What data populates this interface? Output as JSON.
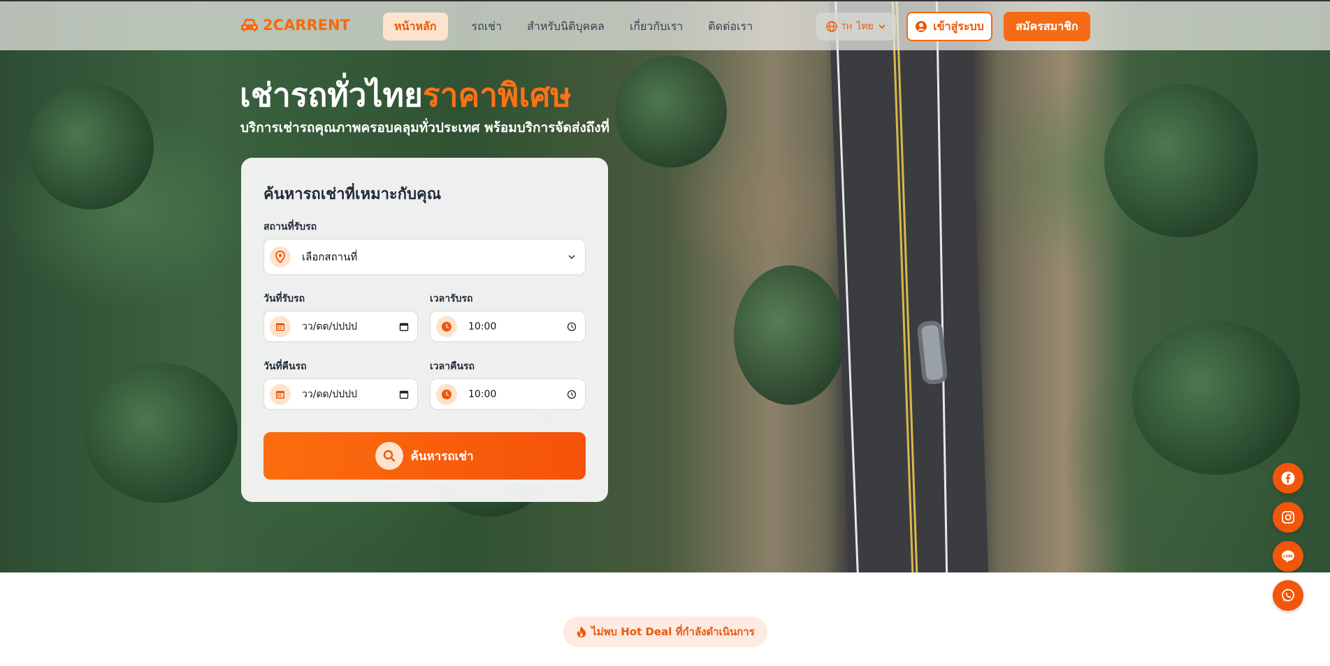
{
  "brand": {
    "name": "2CARRENT",
    "color": "#f26b0f",
    "icon": "car-icon"
  },
  "nav": {
    "items": [
      {
        "label": "หน้าหลัก",
        "active": true
      },
      {
        "label": "รถเช่า",
        "active": false
      },
      {
        "label": "สำหรับนิติบุคคล",
        "active": false
      },
      {
        "label": "เกี่ยวกับเรา",
        "active": false
      },
      {
        "label": "ติดต่อเรา",
        "active": false
      }
    ]
  },
  "language": {
    "code": "TH",
    "label": "ไทย",
    "icon": "globe-icon"
  },
  "auth": {
    "login_label": "เข้าสู่ระบบ",
    "signup_label": "สมัครสมาชิก"
  },
  "hero": {
    "title_main": "เช่ารถทั่วไทย",
    "title_accent": "ราคาพิเศษ",
    "subtitle": "บริการเช่ารถคุณภาพครอบคลุมทั่วประเทศ พร้อมบริการจัดส่งถึงที่"
  },
  "search": {
    "title": "ค้นหารถเช่าที่เหมาะกับคุณ",
    "pickup_location_label": "สถานที่รับรถ",
    "pickup_location_value": "เลือกสถานที่",
    "pickup_date_label": "วันที่รับรถ",
    "pickup_date_value": "วว/ดด/ปปปป",
    "pickup_time_label": "เวลารับรถ",
    "pickup_time_value": "10:00",
    "return_date_label": "วันที่คืนรถ",
    "return_date_value": "วว/ดด/ปปปป",
    "return_time_label": "เวลาคืนรถ",
    "return_time_value": "10:00",
    "button_label": "ค้นหารถเช่า"
  },
  "social": [
    "facebook-icon",
    "instagram-icon",
    "line-icon",
    "whatsapp-icon"
  ],
  "hotdeal": {
    "text": "ไม่พบ Hot Deal ที่กำลังดำเนินการ",
    "icon": "fire-icon"
  },
  "colors": {
    "accent": "#f26b0f",
    "accent_light": "#fde3cc",
    "social": "#f2560a"
  }
}
